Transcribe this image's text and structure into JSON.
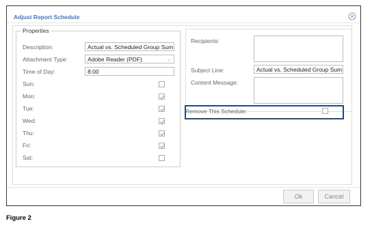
{
  "dialog": {
    "title": "Adjust Report Schedule",
    "close_icon": "close-circle-icon"
  },
  "properties": {
    "legend": "Properties",
    "description": {
      "label": "Description:",
      "value": "Actual vs. Scheduled Group Sum"
    },
    "attachment_type": {
      "label": "Attachment Type:",
      "value": "Adobe Reader (PDF)"
    },
    "time_of_day": {
      "label": "Time of Day:",
      "value": "8:00"
    },
    "days": [
      {
        "label": "Sun:",
        "checked": false
      },
      {
        "label": "Mon:",
        "checked": true
      },
      {
        "label": "Tue:",
        "checked": true
      },
      {
        "label": "Wed:",
        "checked": true
      },
      {
        "label": "Thu:",
        "checked": true
      },
      {
        "label": "Fri:",
        "checked": true
      },
      {
        "label": "Sat:",
        "checked": false
      }
    ]
  },
  "email": {
    "recipients_label": "Recipients:",
    "recipients_value": "",
    "subject_label": "Subject Line:",
    "subject_value": "Actual vs. Scheduled Group Sum",
    "content_label": "Content Message:",
    "content_value": ""
  },
  "remove": {
    "label": "Remove This Schedule:",
    "checked": false
  },
  "footer": {
    "ok_label": "Ok",
    "cancel_label": "Cancel"
  },
  "caption": "Figure 2",
  "colors": {
    "title": "#3a78c2",
    "highlight_border": "#1b4b7a"
  }
}
